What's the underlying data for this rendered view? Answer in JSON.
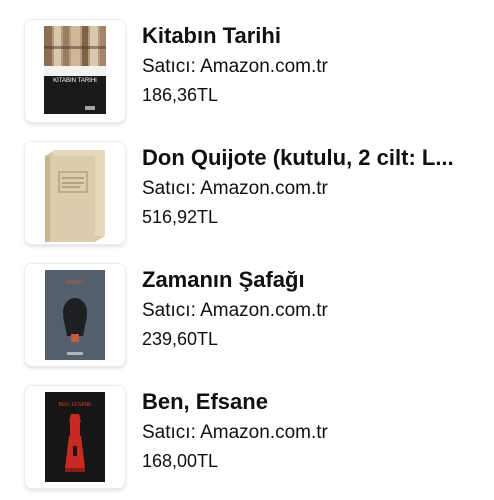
{
  "products": [
    {
      "title": "Kitabın Tarihi",
      "seller": "Satıcı: Amazon.com.tr",
      "price": "186,36TL",
      "cover_text": "KITABIN TARIHI"
    },
    {
      "title": "Don Quijote (kutulu, 2 cilt: L...",
      "seller": "Satıcı: Amazon.com.tr",
      "price": "516,92TL"
    },
    {
      "title": "Zamanın Şafağı",
      "seller": "Satıcı: Amazon.com.tr",
      "price": "239,60TL",
      "cover_text": "ŞAFAĞI"
    },
    {
      "title": "Ben, Efsane",
      "seller": "Satıcı: Amazon.com.tr",
      "price": "168,00TL",
      "cover_text": "BEN, EFSANE"
    }
  ]
}
